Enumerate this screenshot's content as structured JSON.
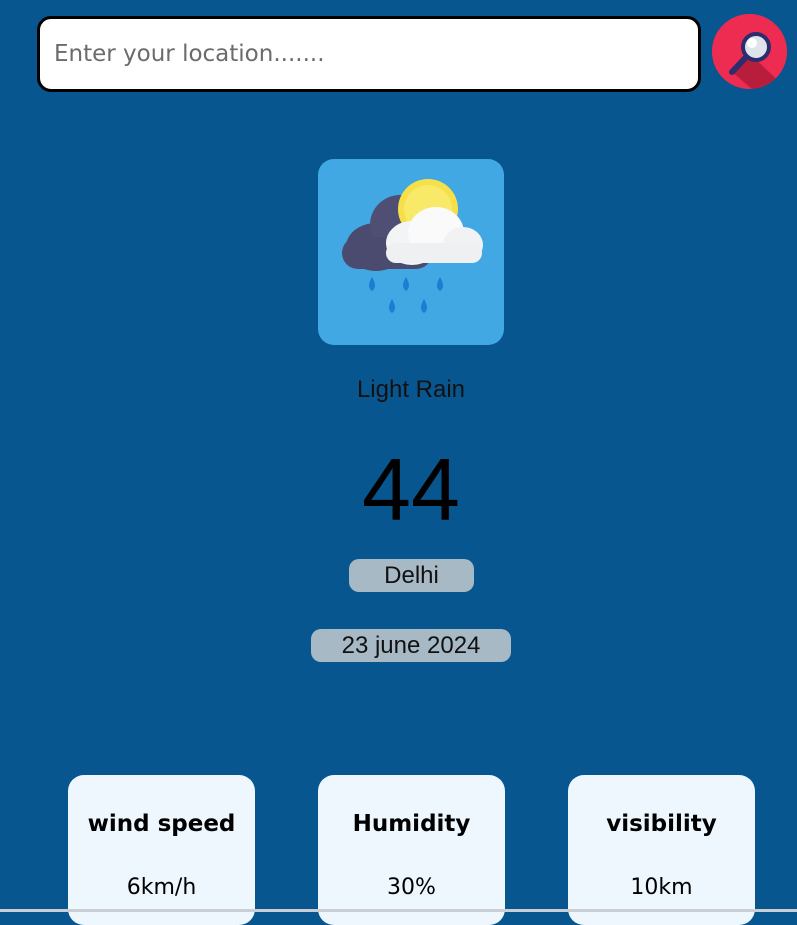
{
  "search": {
    "placeholder": "Enter your location.......",
    "value": "",
    "button_icon": "magnifier-icon",
    "button_color": "#ee2c51"
  },
  "weather": {
    "icon": "cloud-sun-rain-icon",
    "condition": "Light Rain",
    "temperature": "44",
    "city": "Delhi",
    "date": "23 june 2024"
  },
  "stats": [
    {
      "label": "wind speed",
      "value": "6km/h"
    },
    {
      "label": "Humidity",
      "value": "30%"
    },
    {
      "label": "visibility",
      "value": "10km"
    }
  ],
  "colors": {
    "background": "#08568f",
    "icon_box": "#41a8e3",
    "pill": "#a8b9c6",
    "card": "#eef7fd"
  }
}
